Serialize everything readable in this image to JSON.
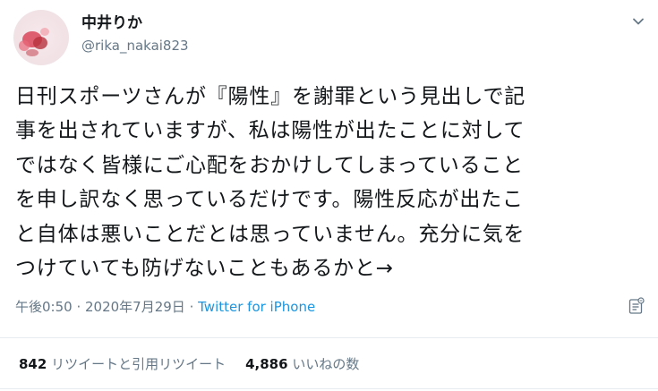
{
  "author": {
    "display_name": "中井りか",
    "handle": "@rika_nakai823",
    "avatar_icon": "profile-photo-flowers"
  },
  "tweet": {
    "lines": [
      "日刊スポーツさんが『陽性』を謝罪という見出しで記",
      "事を出されていますが、私は陽性が出たことに対して",
      "ではなく皆様にご心配をおかけしてしまっていること",
      "を申し訳なく思っているだけです。陽性反応が出たこ",
      "と自体は悪いことだとは思っていません。充分に気を",
      "つけていても防げないこともあるかと→"
    ]
  },
  "meta": {
    "time": "午後0:50",
    "separator": " · ",
    "date": "2020年7月29日",
    "source": "Twitter for iPhone"
  },
  "stats": {
    "retweets_count": "842",
    "retweets_label": "リツイートと引用リツイート",
    "likes_count": "4,886",
    "likes_label": "いいねの数"
  },
  "icons": {
    "caret": "chevron-down-icon",
    "analytics": "analytics-icon"
  },
  "colors": {
    "text": "#14171a",
    "secondary": "#657786",
    "link": "#1b95e0",
    "divider": "#e6ecf0"
  }
}
